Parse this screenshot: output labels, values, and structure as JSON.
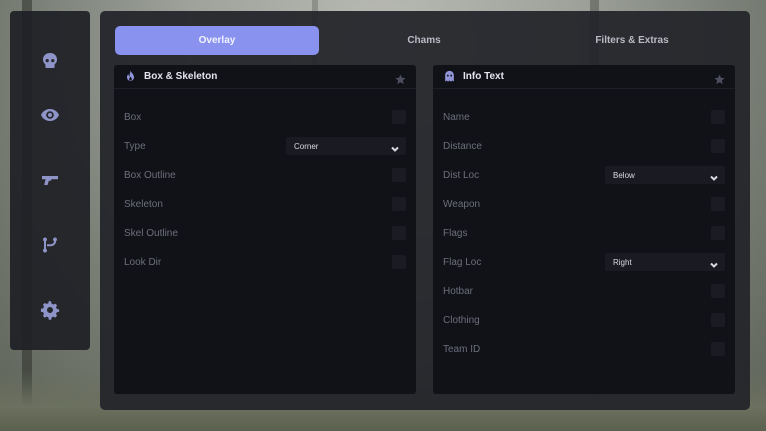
{
  "sidebar": {
    "icons": [
      "skull-icon",
      "eye-icon",
      "gun-icon",
      "branch-icon",
      "gear-icon"
    ]
  },
  "tabs": [
    {
      "label": "Overlay",
      "active": true
    },
    {
      "label": "Chams",
      "active": false
    },
    {
      "label": "Filters & Extras",
      "active": false
    }
  ],
  "panels": {
    "box_skeleton": {
      "title": "Box & Skeleton",
      "icon": "flame-icon",
      "rows": [
        {
          "label": "Box",
          "control": "checkbox"
        },
        {
          "label": "Type",
          "control": "select",
          "value": "Corner"
        },
        {
          "label": "Box Outline",
          "control": "checkbox"
        },
        {
          "label": "Skeleton",
          "control": "checkbox"
        },
        {
          "label": "Skel Outline",
          "control": "checkbox"
        },
        {
          "label": "Look Dir",
          "control": "checkbox"
        }
      ]
    },
    "info_text": {
      "title": "Info Text",
      "icon": "ghost-icon",
      "rows": [
        {
          "label": "Name",
          "control": "checkbox"
        },
        {
          "label": "Distance",
          "control": "checkbox"
        },
        {
          "label": "Dist Loc",
          "control": "select",
          "value": "Below"
        },
        {
          "label": "Weapon",
          "control": "checkbox"
        },
        {
          "label": "Flags",
          "control": "checkbox"
        },
        {
          "label": "Flag Loc",
          "control": "select",
          "value": "Right"
        },
        {
          "label": "Hotbar",
          "control": "checkbox"
        },
        {
          "label": "Clothing",
          "control": "checkbox"
        },
        {
          "label": "Team ID",
          "control": "checkbox"
        }
      ]
    }
  },
  "colors": {
    "accent": "#8a92f0",
    "panel_bg": "#111218",
    "window_bg": "#222329",
    "label": "#6c6f7b"
  }
}
